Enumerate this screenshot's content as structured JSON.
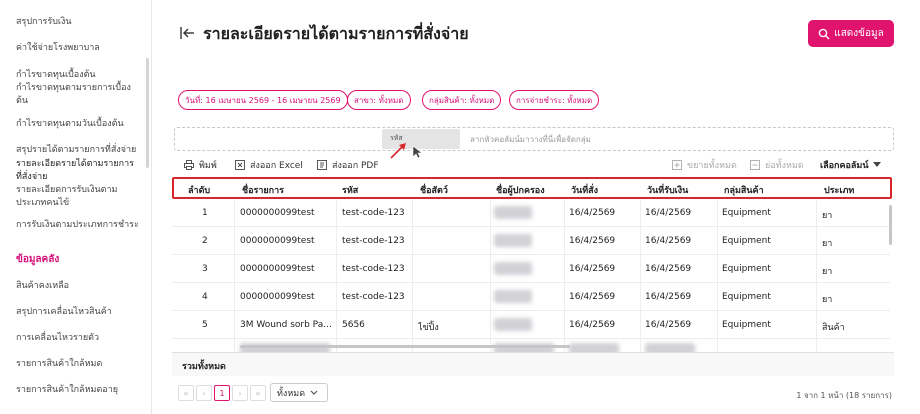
{
  "sidebar": {
    "items": [
      {
        "label": "สรุปการรับเงิน"
      },
      {
        "label": "ค่าใช้จ่ายโรงพยาบาล"
      },
      {
        "label": "กำไรขาดทุนเบื้องต้น"
      },
      {
        "label": "กำไรขาดทุนตามรายการเบื้องต้น"
      },
      {
        "label": "กำไรขาดทุนตามวันเบื้องต้น"
      },
      {
        "label": "สรุปรายได้ตามรายการที่สั่งจ่าย"
      },
      {
        "label": "รายละเอียดรายได้ตามรายการที่สั่งจ่าย"
      },
      {
        "label": "รายละเอียดการรับเงินตามประเภทคนไข้"
      },
      {
        "label": "การรับเงินตามประเภทการชำระ"
      }
    ],
    "section_title": "ข้อมูลคลัง",
    "stock_items": [
      {
        "label": "สินค้าคงเหลือ"
      },
      {
        "label": "สรุปการเคลื่อนไหวสินค้า"
      },
      {
        "label": "การเคลื่อนไหวรายตัว"
      },
      {
        "label": "รายการสินค้าใกล้หมด"
      },
      {
        "label": "รายการสินค้าใกล้หมดอายุ"
      }
    ]
  },
  "header": {
    "title": "รายละเอียดรายได้ตามรายการที่สั่งจ่าย",
    "show_button": "แสดงข้อมูล"
  },
  "filters": [
    {
      "label": "วันที่: 16 เมษายน 2569 - 16 เมษายน 2569"
    },
    {
      "label": "สาขา: ทั้งหมด"
    },
    {
      "label": "กลุ่มสินค้า: ทั้งหมด"
    },
    {
      "label": "การจ่ายชำระ: ทั้งหมด"
    }
  ],
  "group_zone": {
    "hint": "ลากหัวคอลัมน์มาวางที่นี่เพื่อจัดกลุ่ม",
    "dragging_label": "รหัส"
  },
  "toolbar": {
    "print": "พิมพ์",
    "export_excel": "ส่งออก Excel",
    "export_pdf": "ส่งออก PDF",
    "expand_all": "ขยายทั้งหมด",
    "collapse_all": "ย่อทั้งหมด",
    "choose_columns": "เลือกคอลัมน์"
  },
  "table": {
    "columns": [
      "ลำดับ",
      "ชื่อรายการ",
      "รหัส",
      "ชื่อสัตว์",
      "ชื่อผู้ปกครอง",
      "วันที่สั่ง",
      "วันที่รับเงิน",
      "กลุ่มสินค้า",
      "ประเภท"
    ],
    "rows": [
      [
        "1",
        "0000000099test",
        "test-code-123",
        "",
        "",
        "16/4/2569",
        "16/4/2569",
        "Equipment",
        "ยา"
      ],
      [
        "2",
        "0000000099test",
        "test-code-123",
        "",
        "",
        "16/4/2569",
        "16/4/2569",
        "Equipment",
        "ยา"
      ],
      [
        "3",
        "0000000099test",
        "test-code-123",
        "",
        "",
        "16/4/2569",
        "16/4/2569",
        "Equipment",
        "ยา"
      ],
      [
        "4",
        "0000000099test",
        "test-code-123",
        "",
        "",
        "16/4/2569",
        "16/4/2569",
        "Equipment",
        "ยา"
      ],
      [
        "5",
        "3M Wound sorb Pa...",
        "5656",
        "ไข่ปิ้ง",
        "",
        "16/4/2569",
        "16/4/2569",
        "Equipment",
        "สินค้า"
      ]
    ],
    "total_label": "รวมทั้งหมด"
  },
  "pager": {
    "first": "«",
    "prev": "‹",
    "current_page": "1",
    "next": "›",
    "last": "»",
    "page_size": "ทั้งหมด",
    "info": "1 จาก 1 หน้า (18 รายการ)"
  }
}
